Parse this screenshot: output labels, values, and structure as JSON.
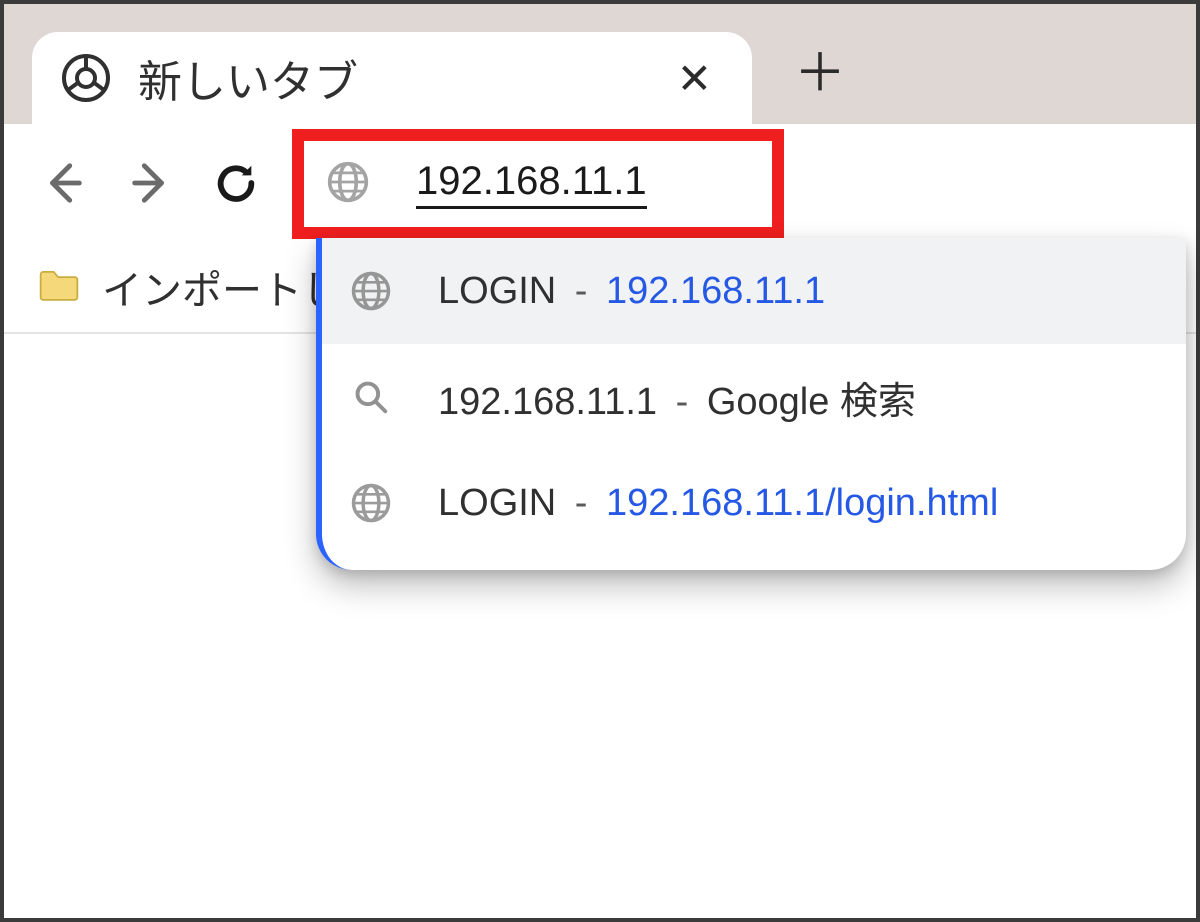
{
  "tab": {
    "title": "新しいタブ"
  },
  "address": {
    "value": "192.168.11.1"
  },
  "bookmarks_bar": {
    "imported_label": "インポートした"
  },
  "suggestions": [
    {
      "icon": "globe",
      "title": "LOGIN",
      "url": "192.168.11.1"
    },
    {
      "icon": "search",
      "title": "192.168.11.1",
      "suffix": "Google 検索"
    },
    {
      "icon": "globe",
      "title": "LOGIN",
      "url": "192.168.11.1/login.html"
    }
  ],
  "colors": {
    "highlight_border": "#ef1f1f",
    "link": "#2558e5",
    "tabstrip_bg": "#dfd7d4"
  }
}
